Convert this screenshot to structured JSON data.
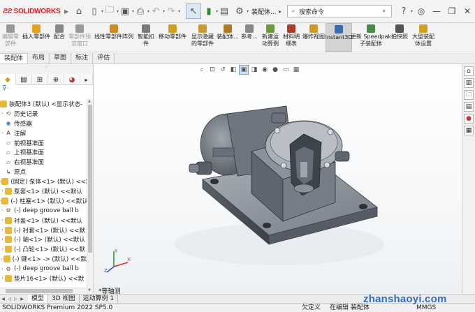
{
  "app": {
    "logo_text": "SOLIDWORKS",
    "doc_title": "装配体...",
    "search_placeholder": "搜索命令"
  },
  "command_manager": [
    {
      "label": "编辑零\n部件",
      "icon": "edit-component-icon",
      "color": "#9a9a9a",
      "disabled": true
    },
    {
      "label": "插入零部件",
      "icon": "insert-component-icon",
      "color": "#e3a21a",
      "disabled": false
    },
    {
      "label": "配合",
      "icon": "mate-icon",
      "color": "#888888",
      "disabled": false
    },
    {
      "label": "零部件预\n览窗口",
      "icon": "component-preview-icon",
      "color": "#9a9a9a",
      "disabled": true
    },
    {
      "label": "线性零部件阵列",
      "icon": "linear-pattern-icon",
      "color": "#d08a1e",
      "disabled": false
    },
    {
      "label": "智能扣\n件",
      "icon": "smart-fastener-icon",
      "color": "#7a7a7a",
      "disabled": false
    },
    {
      "label": "移动零部件",
      "icon": "move-component-icon",
      "color": "#d0a020",
      "disabled": false
    },
    {
      "label": "显示隐藏\n的零部件",
      "icon": "show-hidden-icon",
      "color": "#c89a30",
      "disabled": false
    },
    {
      "label": "装配体...",
      "icon": "assembly-features-icon",
      "color": "#b07a20",
      "disabled": false
    },
    {
      "label": "参考...",
      "icon": "reference-geometry-icon",
      "color": "#888888",
      "disabled": false
    },
    {
      "label": "新建运\n动算例",
      "icon": "new-motion-study-icon",
      "color": "#6a9a3a",
      "disabled": false
    },
    {
      "label": "材料明\n细表",
      "icon": "bom-icon",
      "color": "#b03a2a",
      "disabled": false
    },
    {
      "label": "爆炸视图",
      "icon": "exploded-view-icon",
      "color": "#d09a2a",
      "disabled": false
    },
    {
      "label": "Instant3D",
      "icon": "instant3d-icon",
      "color": "#3a6ab0",
      "disabled": false,
      "active": true
    },
    {
      "label": "更新 Speedpak\n子装配体",
      "icon": "speedpak-icon",
      "color": "#4a8a4a",
      "disabled": false
    },
    {
      "label": "拍快照",
      "icon": "snapshot-icon",
      "color": "#555555",
      "disabled": false
    },
    {
      "label": "大型装配\n体设置",
      "icon": "large-assembly-icon",
      "color": "#d0a020",
      "disabled": false
    }
  ],
  "command_tabs": [
    "装配体",
    "布局",
    "草图",
    "标注",
    "评估"
  ],
  "active_command_tab": "装配体",
  "tree": {
    "root": "装配体3 (默认) <显示状态-",
    "items": [
      {
        "label": "历史记录",
        "icon": "history-icon",
        "expand": true
      },
      {
        "label": "传感器",
        "icon": "sensor-icon",
        "expand": false
      },
      {
        "label": "注解",
        "icon": "annotation-icon",
        "expand": true
      },
      {
        "label": "前视基准面",
        "icon": "plane-icon",
        "expand": false
      },
      {
        "label": "上视基准面",
        "icon": "plane-icon",
        "expand": false
      },
      {
        "label": "右视基准面",
        "icon": "plane-icon",
        "expand": false
      },
      {
        "label": "原点",
        "icon": "origin-icon",
        "expand": false
      },
      {
        "label": "(固定) 泵体<1> (默认) <<默",
        "icon": "part-icon",
        "expand": true
      },
      {
        "label": "泵套<1> (默认) <<默认",
        "icon": "part-icon",
        "expand": true
      },
      {
        "label": "(-) 柱塞<1> (默认) <<默认",
        "icon": "part-icon",
        "expand": true
      },
      {
        "label": "(-) deep groove ball b",
        "icon": "toolbox-part-icon",
        "expand": true
      },
      {
        "label": "衬盖<1> (默认) <<默认",
        "icon": "part-icon",
        "expand": true
      },
      {
        "label": "(-) 衬套<1> (默认) <<默",
        "icon": "part-icon",
        "expand": true
      },
      {
        "label": "(-) 轴<1> (默认) <<默认",
        "icon": "part-icon",
        "expand": true
      },
      {
        "label": "(-) 凸轮<1> (默认) <<默",
        "icon": "part-icon",
        "expand": true
      },
      {
        "label": "(-) 键<1> -> (默认) <<默",
        "icon": "part-icon",
        "expand": true
      },
      {
        "label": "(-) deep groove ball b",
        "icon": "toolbox-part-icon",
        "expand": true
      },
      {
        "label": "垫片16<1> (默认) <<默",
        "icon": "part-icon",
        "expand": true
      }
    ]
  },
  "viewport": {
    "view_name": "*等轴测"
  },
  "bottom_tabs": [
    "模型",
    "3D 视图",
    "运动算例 1"
  ],
  "active_bottom_tab": "模型",
  "status": {
    "product": "SOLIDWORKS Premium 2022 SP5.0",
    "under_defined": "欠定义",
    "editing": "在编辑 装配体",
    "units": "MMGS"
  },
  "watermark": "zhanshaoyi.com"
}
